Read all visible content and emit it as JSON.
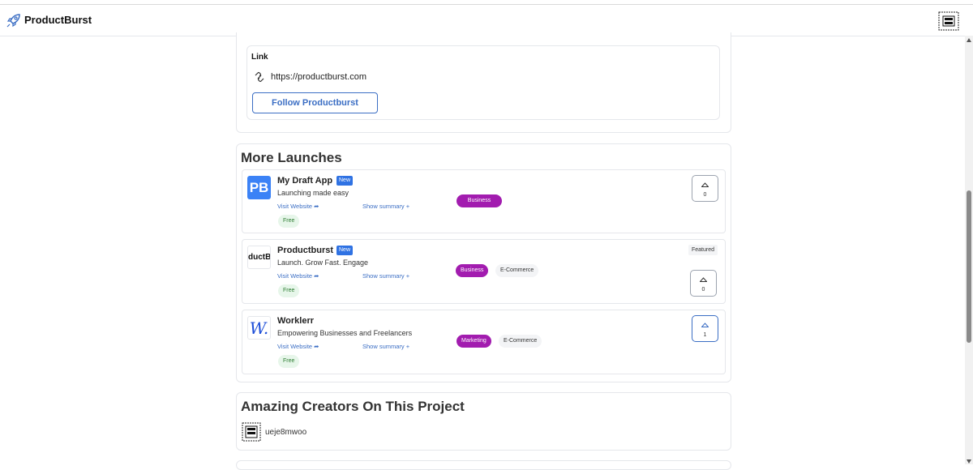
{
  "header": {
    "brand": "ProductBurst",
    "logo_icon": "rocket-icon",
    "avatar_icon": "word-mess-avatar"
  },
  "link_section": {
    "label": "Link",
    "url": "https://productburst.com",
    "follow_button": "Follow Productburst"
  },
  "more_launches": {
    "title": "More Launches",
    "items": [
      {
        "thumb_text": "PB",
        "name": "My Draft App",
        "new_badge": "New",
        "tagline": "Launching made easy",
        "visit": "Visit Website",
        "summary": "Show summary",
        "pricing": "Free",
        "tags": [
          "Business"
        ],
        "featured": "",
        "votes": "0"
      },
      {
        "thumb_text": "ductBu",
        "name": "Productburst",
        "new_badge": "New",
        "tagline": "Launch. Grow Fast. Engage",
        "visit": "Visit Website",
        "summary": "Show summary",
        "pricing": "Free",
        "tags": [
          "Business",
          "E-Commerce"
        ],
        "featured": "Featured",
        "votes": "0"
      },
      {
        "thumb_text": "W.",
        "name": "Worklerr",
        "new_badge": "",
        "tagline": "Empowering Businesses and Freelancers",
        "visit": "Visit Website",
        "summary": "Show summary",
        "pricing": "Free",
        "tags": [
          "Marketing",
          "E-Commerce"
        ],
        "featured": "",
        "votes": "1"
      }
    ]
  },
  "creators": {
    "title": "Amazing Creators On This Project",
    "name": "ueje8mwoo"
  },
  "colors": {
    "accent": "#3b6ec4",
    "tag_purple": "#a21caf",
    "new_badge": "#2f72e3",
    "free_green": "#2e7d32"
  }
}
